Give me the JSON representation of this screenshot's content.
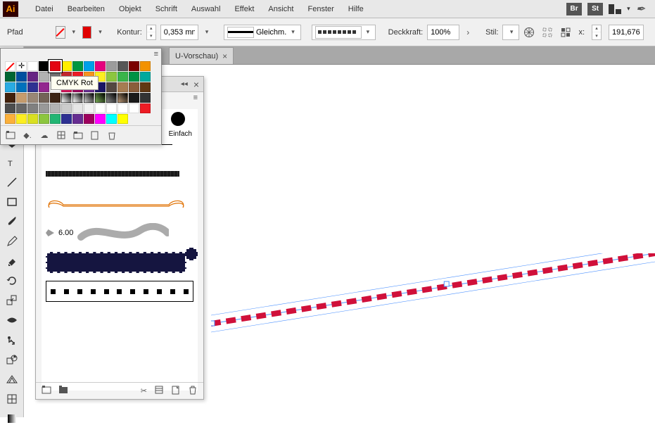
{
  "app": {
    "icon_text": "Ai"
  },
  "menu": {
    "items": [
      "Datei",
      "Bearbeiten",
      "Objekt",
      "Schrift",
      "Auswahl",
      "Effekt",
      "Ansicht",
      "Fenster",
      "Hilfe"
    ],
    "badges": [
      "Br",
      "St"
    ]
  },
  "control": {
    "selection_label": "Pfad",
    "stroke_label": "Kontur:",
    "stroke_weight": "0,353 mn",
    "profile_label": "Gleichm.",
    "opacity_label": "Deckkraft:",
    "opacity_value": "100%",
    "style_label": "Stil:",
    "x_label": "x:",
    "x_value": "191,676"
  },
  "tab": {
    "title": "U-Vorschau)",
    "close": "×"
  },
  "swatches": {
    "tooltip": "CMYK Rot",
    "row1": [
      "#ffffff",
      "#000000",
      "#e30613",
      "#ffed00",
      "#009640",
      "#00a0e9",
      "#e6007e",
      "#9c9c9c",
      "#565656",
      "#7b0000",
      "#f39200",
      "#006633",
      "#004f9f",
      "#662483"
    ],
    "row2": [
      "#b2b2b2",
      "#706f6f",
      "#c1272d",
      "#ed1c24",
      "#f7931e",
      "#fcee21",
      "#8cc63f",
      "#39b54a",
      "#009245",
      "#00a99d",
      "#29abe2",
      "#0071bc",
      "#2e3192",
      "#93278f"
    ],
    "row3": [
      "#ffffff",
      "#d4145a",
      "#9e005d",
      "#662d91",
      "#1b1464",
      "#534741",
      "#a67c52",
      "#8a5d3b",
      "#603813",
      "#42210b",
      "#c69c6d",
      "#998675",
      "#736357",
      "#3c2415"
    ],
    "row4_gray": [
      "#1a1a1a",
      "#333333",
      "#4d4d4d",
      "#666666",
      "#808080",
      "#999999",
      "#b3b3b3",
      "#cccccc",
      "#e6e6e6",
      "#f2f2f2"
    ],
    "row5_bright": [
      "#ed1c24",
      "#fbb03b",
      "#fcee21",
      "#d9e021",
      "#8cc63f",
      "#22b573",
      "#2e3192",
      "#662d91",
      "#9e005d",
      "#ff00ff",
      "#00ffff",
      "#ffff00"
    ]
  },
  "brushes": {
    "basic_label": "Einfach",
    "size_value": "6.00"
  },
  "tool_names": [
    "selection",
    "direct-selection",
    "pen",
    "curvature",
    "type",
    "line",
    "rectangle",
    "brush",
    "pencil",
    "eraser",
    "rotate",
    "scale",
    "width",
    "free-transform",
    "shape-builder",
    "perspective",
    "mesh",
    "gradient",
    "default-fill"
  ]
}
